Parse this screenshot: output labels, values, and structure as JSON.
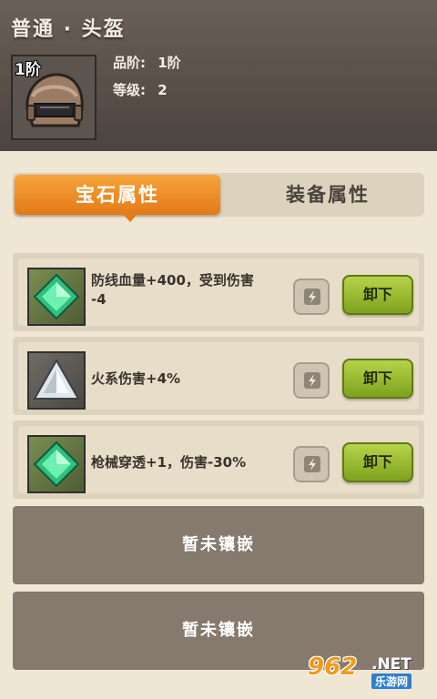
{
  "header": {
    "title": "普通 · 头盔",
    "tier_badge": "1阶",
    "grade_label": "品阶:",
    "grade_value": "1阶",
    "level_label": "等级:",
    "level_value": "2",
    "item_icon": "helmet-icon"
  },
  "tabs": [
    {
      "label": "宝石属性",
      "active": true
    },
    {
      "label": "装备属性",
      "active": false
    }
  ],
  "gems": [
    {
      "icon": "green-gem-icon",
      "text_line1": "防线血量+400，受到伤害",
      "text_line2": "-4",
      "action_label": "卸下"
    },
    {
      "icon": "white-triangle-gem-icon",
      "text_line1": "火系伤害+4%",
      "text_line2": "",
      "action_label": "卸下"
    },
    {
      "icon": "green-gem-icon",
      "text_line1": "枪械穿透+1，伤害-30%",
      "text_line2": "",
      "action_label": "卸下"
    }
  ],
  "empty_slots": [
    {
      "label": "暂未镶嵌"
    },
    {
      "label": "暂未镶嵌"
    }
  ],
  "watermark": {
    "logo": "962",
    "net": ".NET",
    "sub": "乐游网"
  },
  "colors": {
    "header_bg": "#5a5049",
    "tab_active": "#e47a18",
    "button_green": "#8fb22a",
    "empty_slot_bg": "#867a6e",
    "page_bg": "#efe6d4"
  }
}
